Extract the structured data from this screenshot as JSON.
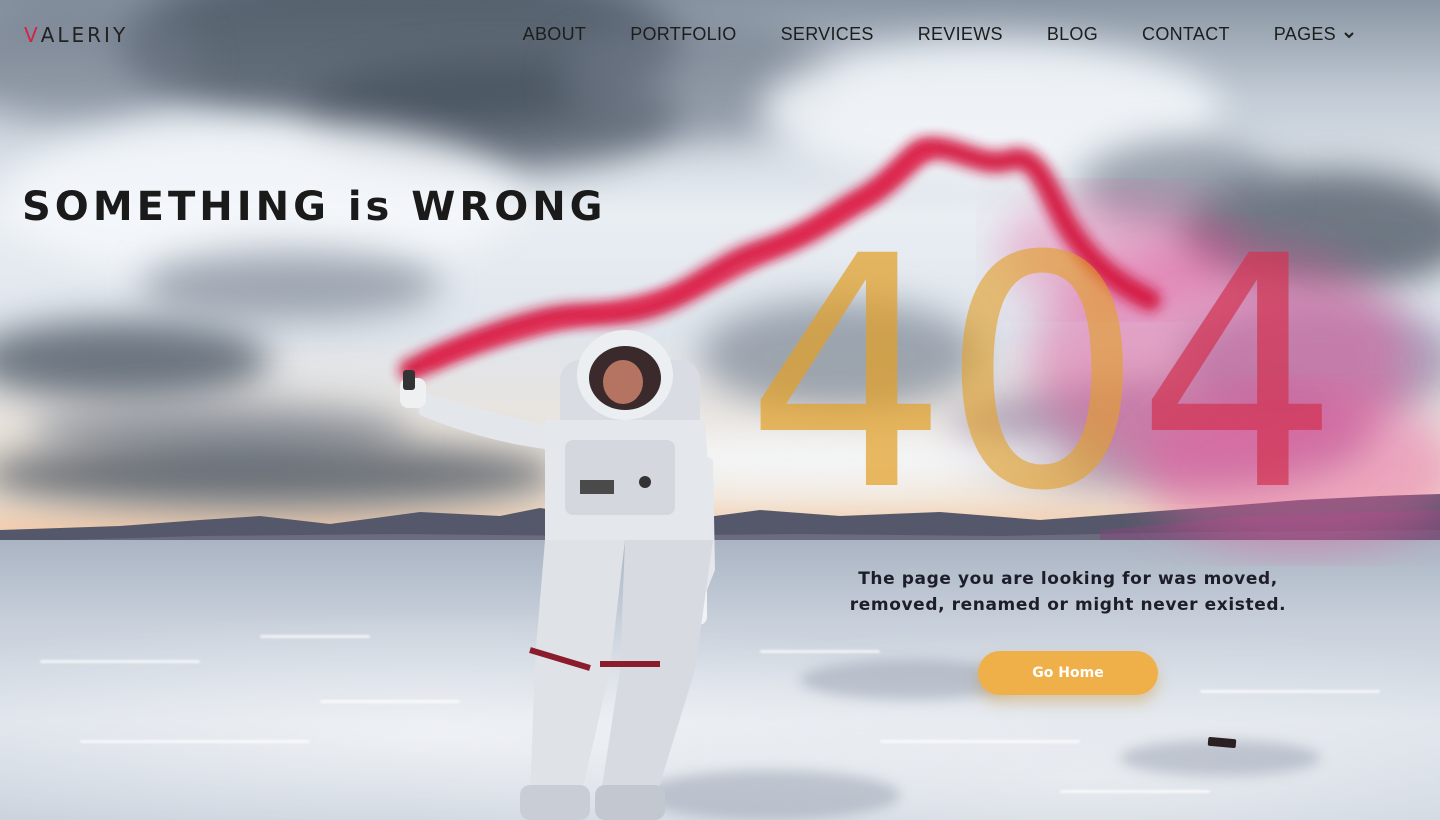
{
  "brand": {
    "logo_first": "V",
    "logo_rest": "ALERIY",
    "accent_color": "#d4234a"
  },
  "nav": {
    "items": [
      {
        "label": "ABOUT"
      },
      {
        "label": "PORTFOLIO"
      },
      {
        "label": "SERVICES"
      },
      {
        "label": "REVIEWS"
      },
      {
        "label": "BLOG"
      },
      {
        "label": "CONTACT"
      },
      {
        "label": "PAGES",
        "icon": "chevron-down-icon"
      }
    ]
  },
  "hero": {
    "headline": "SOMETHING is WRONG",
    "error_code_digits": [
      "4",
      "0",
      "4"
    ],
    "message": "The page you are looking for was moved, removed, renamed or might never existed.",
    "button_label": "Go Home",
    "button_color": "#efb04a",
    "digit_colors": [
      "#e2a028",
      "#e2a028",
      "#d23250"
    ]
  }
}
